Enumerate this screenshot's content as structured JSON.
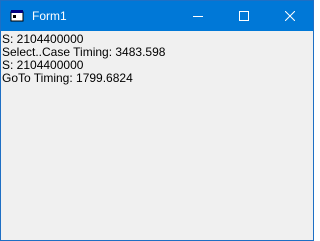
{
  "window": {
    "title": "Form1",
    "title_bar_color": "#0078d7",
    "title_icon": "form-icon",
    "controls": [
      "minimize-icon",
      "maximize-icon",
      "close-icon"
    ]
  },
  "output": {
    "lines": [
      "S: 2104400000",
      "Select..Case Timing: 3483.598",
      "S: 2104400000",
      "GoTo Timing: 1799.6824"
    ]
  }
}
